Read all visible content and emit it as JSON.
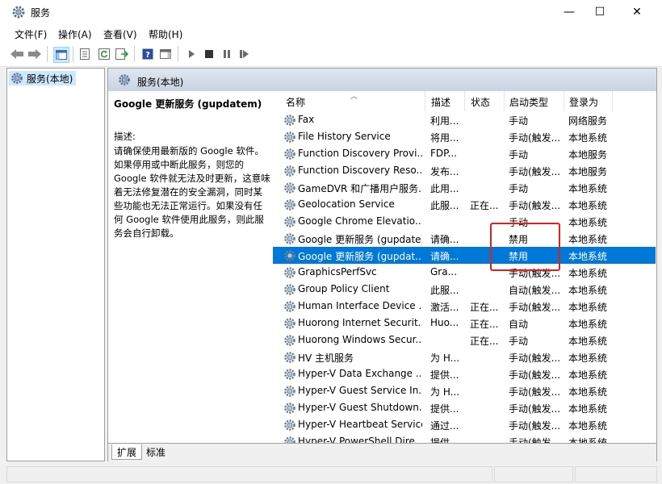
{
  "window": {
    "title": "服务",
    "minimize": "—",
    "maximize": "☐",
    "close": "✕"
  },
  "menu": [
    "文件(F)",
    "操作(A)",
    "查看(V)",
    "帮助(H)"
  ],
  "tree": {
    "root": "服务(本地)"
  },
  "panel": {
    "title": "服务(本地)"
  },
  "description": {
    "service_name": "Google 更新服务 (gupdatem)",
    "label": "描述:",
    "text": "请确保使用最新版的 Google 软件。如果停用或中断此服务，则您的 Google 软件就无法及时更新，这意味着无法修复潜在的安全漏洞，同时某些功能也无法正常运行。如果没有任何 Google 软件使用此服务，则此服务会自行卸载。"
  },
  "columns": {
    "name": "名称",
    "desc": "描述",
    "status": "状态",
    "startup": "启动类型",
    "logon": "登录为"
  },
  "services": [
    {
      "name": "Fax",
      "desc": "利用...",
      "status": "",
      "startup": "手动",
      "logon": "网络服务"
    },
    {
      "name": "File History Service",
      "desc": "将用...",
      "status": "",
      "startup": "手动(触发...",
      "logon": "本地系统"
    },
    {
      "name": "Function Discovery Provi...",
      "desc": "FDP...",
      "status": "",
      "startup": "手动",
      "logon": "本地服务"
    },
    {
      "name": "Function Discovery Reso...",
      "desc": "发布...",
      "status": "",
      "startup": "手动(触发...",
      "logon": "本地服务"
    },
    {
      "name": "GameDVR 和广播用户服务...",
      "desc": "此用...",
      "status": "",
      "startup": "手动",
      "logon": "本地系统"
    },
    {
      "name": "Geolocation Service",
      "desc": "此服...",
      "status": "正在...",
      "startup": "手动(触发...",
      "logon": "本地系统"
    },
    {
      "name": "Google Chrome Elevatio...",
      "desc": "",
      "status": "",
      "startup": "手动",
      "logon": "本地系统"
    },
    {
      "name": "Google 更新服务 (gupdate)",
      "desc": "请确...",
      "status": "",
      "startup": "禁用",
      "logon": "本地系统"
    },
    {
      "name": "Google 更新服务 (gupdat...",
      "desc": "请确...",
      "status": "",
      "startup": "禁用",
      "logon": "本地系统"
    },
    {
      "name": "GraphicsPerfSvc",
      "desc": "Gra...",
      "status": "",
      "startup": "手动(触发...",
      "logon": "本地系统"
    },
    {
      "name": "Group Policy Client",
      "desc": "此服...",
      "status": "",
      "startup": "自动(触发...",
      "logon": "本地系统"
    },
    {
      "name": "Human Interface Device ...",
      "desc": "激活...",
      "status": "正在...",
      "startup": "手动(触发...",
      "logon": "本地系统"
    },
    {
      "name": "Huorong Internet Securit...",
      "desc": "Huo...",
      "status": "正在...",
      "startup": "自动",
      "logon": "本地系统"
    },
    {
      "name": "Huorong Windows Secur...",
      "desc": "",
      "status": "正在...",
      "startup": "手动",
      "logon": "本地系统"
    },
    {
      "name": "HV 主机服务",
      "desc": "为 H...",
      "status": "",
      "startup": "手动(触发...",
      "logon": "本地系统"
    },
    {
      "name": "Hyper-V Data Exchange ...",
      "desc": "提供...",
      "status": "",
      "startup": "手动(触发...",
      "logon": "本地系统"
    },
    {
      "name": "Hyper-V Guest Service In...",
      "desc": "为 H...",
      "status": "",
      "startup": "手动(触发...",
      "logon": "本地系统"
    },
    {
      "name": "Hyper-V Guest Shutdown...",
      "desc": "提供...",
      "status": "",
      "startup": "手动(触发...",
      "logon": "本地系统"
    },
    {
      "name": "Hyper-V Heartbeat Service",
      "desc": "通过...",
      "status": "",
      "startup": "手动(触发...",
      "logon": "本地系统"
    },
    {
      "name": "Hyper-V PowerShell Dire...",
      "desc": "提供...",
      "status": "",
      "startup": "手动(触发...",
      "logon": "本地系统"
    }
  ],
  "selected_index": 8,
  "tabs": [
    "扩展",
    "标准"
  ],
  "colors": {
    "selection": "#0078d7",
    "highlight_box": "#e02020",
    "header_band": "#c9d3e2"
  }
}
